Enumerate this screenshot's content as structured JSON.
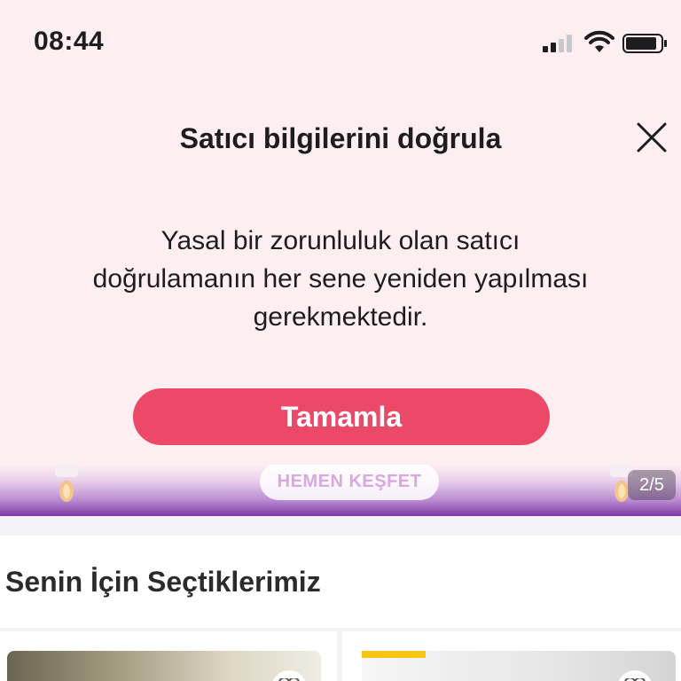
{
  "status_bar": {
    "time": "08:44",
    "icons": [
      "signal-icon",
      "wifi-icon",
      "battery-icon"
    ]
  },
  "modal": {
    "title": "Satıcı bilgilerini doğrula",
    "message": "Yasal bir zorunluluk olan satıcı doğrulamanın her sene yeniden yapılması gerekmektedir.",
    "button_label": "Tamamla",
    "close_icon": "close-icon"
  },
  "banner": {
    "cta_label": "HEMEN KEŞFET",
    "page_indicator": "2/5"
  },
  "section": {
    "title": "Senin İçin Seçtiklerimiz"
  },
  "colors": {
    "modal_background": "#fdeff1",
    "primary": "#ec4868",
    "badge": "#f7c515",
    "page_background": "#f3f3f5"
  }
}
